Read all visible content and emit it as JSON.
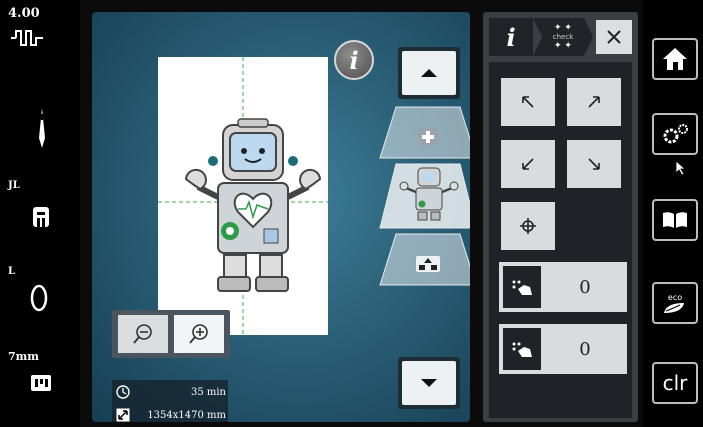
{
  "leftbar": {
    "stitch_length": "4.00",
    "needle_plate_label": "JL",
    "presser_foot_label": "L",
    "hoop_size_label": "7mm"
  },
  "canvas": {
    "info_label": "i",
    "stitch_time": "35 min",
    "design_size": "1354x1470 mm"
  },
  "right_panel": {
    "tab_info_label": "i",
    "tab_check_label": "check",
    "step_rows": [
      {
        "value": "0"
      },
      {
        "value": "0"
      }
    ]
  },
  "nav": {
    "clr_label": "clr"
  },
  "colors": {
    "canvas_center": "#3e7e96",
    "canvas_edge": "#173e52",
    "panel": "#3b3f44",
    "button_light": "#d9dcdf"
  },
  "icons": [
    "stitch-pattern-icon",
    "needle-icon",
    "needle-plate-icon",
    "presser-foot-icon",
    "hoop-icon",
    "zoom-out-icon",
    "zoom-in-icon",
    "clock-icon",
    "resize-icon",
    "arrow-up-icon",
    "arrow-down-icon",
    "plus-icon",
    "home-icon",
    "settings-icon",
    "book-icon",
    "eco-icon",
    "close-icon",
    "move-up-left-icon",
    "move-up-right-icon",
    "move-down-left-icon",
    "move-down-right-icon",
    "center-crosshair-icon",
    "hand-step-icon"
  ]
}
